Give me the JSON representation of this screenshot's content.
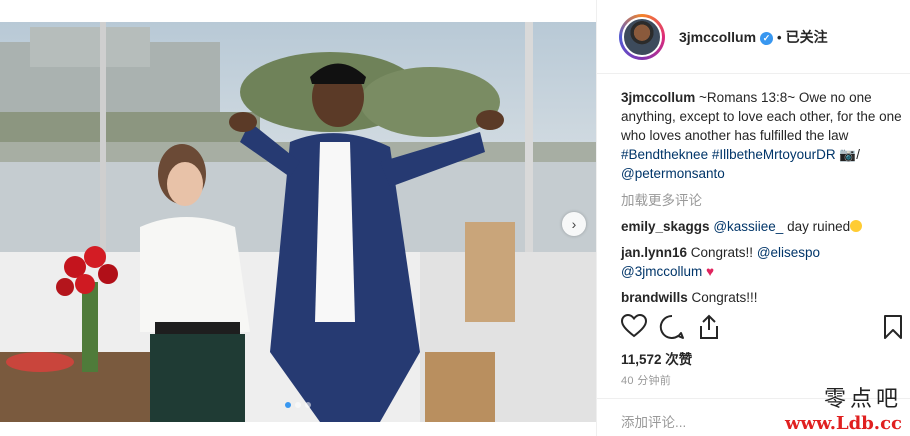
{
  "post": {
    "image_alt": "",
    "carousel_dots": 3,
    "active_dot": 0
  },
  "header": {
    "username": "3jmccollum",
    "follow_label": "已关注",
    "separator": "•"
  },
  "caption": {
    "username": "3jmccollum",
    "text": "~Romans 13:8~ Owe no one anything, except to love each other, for the one who loves another has fulfilled the law",
    "hashtags": [
      "#Bendtheknee",
      "#IllbetheMrtoyourDR"
    ],
    "camera_emoji": "📷",
    "slash": "/",
    "mention": "@petermonsanto"
  },
  "load_more": "加载更多评论",
  "comments": [
    {
      "username": "emily_skaggs",
      "mention": "@kassiiee_",
      "text": " day ruined"
    },
    {
      "username": "jan.lynn16",
      "text": " Congrats!! ",
      "mention": "@elisespo",
      "mention2": "@3jmccollum"
    },
    {
      "username": "brandwills",
      "text": " Congrats!!!"
    }
  ],
  "likes": "11,572 次赞",
  "timestamp": "40 分钟前",
  "add_comment_placeholder": "添加评论...",
  "watermark": {
    "line1": "零点吧",
    "line2": "www.Ldb.cc"
  },
  "colors": {
    "link": "#003569",
    "verified": "#3897f0",
    "muted": "#999999"
  }
}
